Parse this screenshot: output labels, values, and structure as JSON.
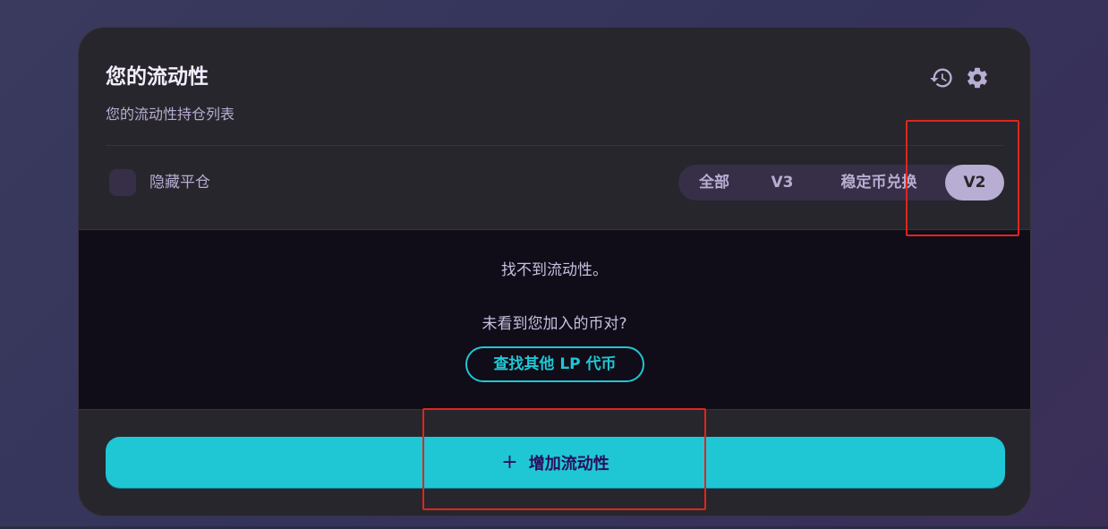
{
  "header": {
    "title": "您的流动性",
    "subtitle": "您的流动性持仓列表",
    "icons": [
      "history-icon",
      "gear-icon"
    ]
  },
  "filters": {
    "hide_closed_label": "隐藏平仓",
    "tabs": [
      {
        "label": "全部",
        "active": false
      },
      {
        "label": "V3",
        "active": false
      },
      {
        "label": "稳定币兑换",
        "active": false
      },
      {
        "label": "V2",
        "active": true
      }
    ]
  },
  "empty_state": {
    "message": "找不到流动性。",
    "prompt": "未看到您加入的币对?",
    "find_button": "查找其他 LP 代币"
  },
  "footer": {
    "add_button_icon": "+",
    "add_button_label": "增加流动性"
  },
  "colors": {
    "accent": "#1fc7d4",
    "card_bg": "#27262c",
    "text_secondary": "#b8add2",
    "annotation": "#e0251c"
  }
}
